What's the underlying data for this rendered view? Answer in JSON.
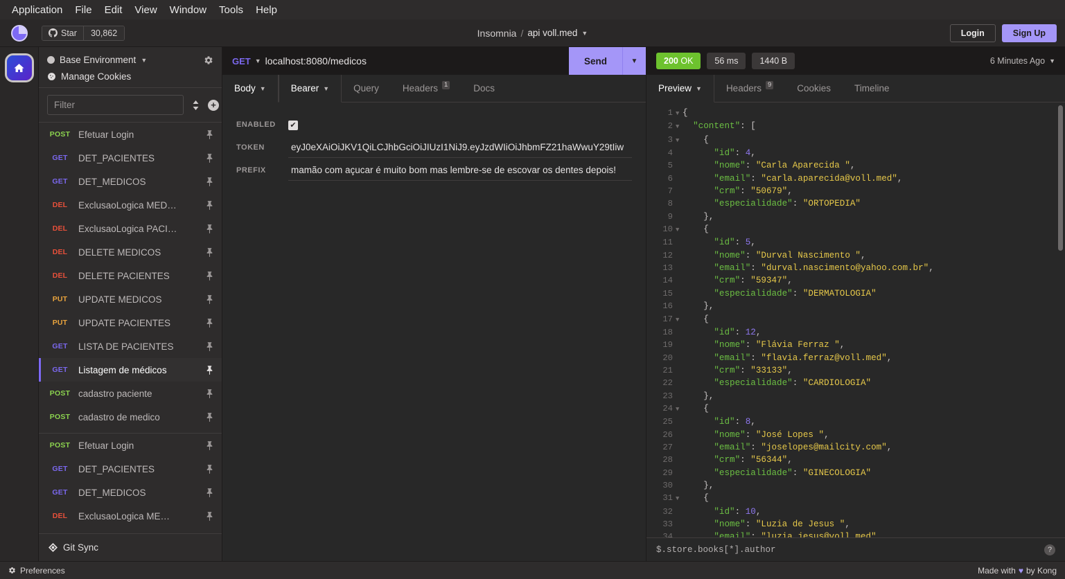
{
  "menubar": [
    "Application",
    "File",
    "Edit",
    "View",
    "Window",
    "Tools",
    "Help"
  ],
  "header": {
    "star_label": "Star",
    "star_count": "30,862",
    "app_name": "Insomnia",
    "separator": "/",
    "workspace": "api voll.med",
    "login_label": "Login",
    "signup_label": "Sign Up",
    "accent": "#a496f8"
  },
  "sidebar": {
    "environment": "Base Environment",
    "manage_cookies": "Manage Cookies",
    "filter_placeholder": "Filter",
    "git_sync": "Git Sync",
    "requests": [
      {
        "method": "POST",
        "name": "Efetuar Login",
        "active": false
      },
      {
        "method": "GET",
        "name": "DET_PACIENTES",
        "active": false
      },
      {
        "method": "GET",
        "name": "DET_MEDICOS",
        "active": false
      },
      {
        "method": "DEL",
        "name": "ExclusaoLogica MED…",
        "active": false
      },
      {
        "method": "DEL",
        "name": "ExclusaoLogica PACI…",
        "active": false
      },
      {
        "method": "DEL",
        "name": "DELETE MEDICOS",
        "active": false
      },
      {
        "method": "DEL",
        "name": "DELETE PACIENTES",
        "active": false
      },
      {
        "method": "PUT",
        "name": "UPDATE MEDICOS",
        "active": false
      },
      {
        "method": "PUT",
        "name": "UPDATE PACIENTES",
        "active": false
      },
      {
        "method": "GET",
        "name": "LISTA DE PACIENTES",
        "active": false
      },
      {
        "method": "GET",
        "name": "Listagem de médicos",
        "active": true
      },
      {
        "method": "POST",
        "name": "cadastro paciente",
        "active": false
      },
      {
        "method": "POST",
        "name": "cadastro de medico",
        "active": false
      }
    ],
    "requests_group2": [
      {
        "method": "POST",
        "name": "Efetuar Login",
        "active": false
      },
      {
        "method": "GET",
        "name": "DET_PACIENTES",
        "active": false
      },
      {
        "method": "GET",
        "name": "DET_MEDICOS",
        "active": false
      },
      {
        "method": "DEL",
        "name": "ExclusaoLogica ME…",
        "active": false
      }
    ]
  },
  "request": {
    "method": "GET",
    "url": "localhost:8080/medicos",
    "send_label": "Send",
    "tabs": [
      {
        "label": "Body",
        "active": true,
        "caret": true,
        "badge": ""
      },
      {
        "label": "Bearer",
        "active": true,
        "caret": true,
        "badge": ""
      },
      {
        "label": "Query",
        "active": false,
        "caret": false,
        "badge": ""
      },
      {
        "label": "Headers",
        "active": false,
        "caret": false,
        "badge": "1"
      },
      {
        "label": "Docs",
        "active": false,
        "caret": false,
        "badge": ""
      }
    ],
    "fields": {
      "enabled_label": "ENABLED",
      "enabled_checked": true,
      "token_label": "TOKEN",
      "token_value": "eyJ0eXAiOiJKV1QiLCJhbGciOiJIUzI1NiJ9.eyJzdWIiOiJhbmFZ21haWwuY29tIiw",
      "prefix_label": "PREFIX",
      "prefix_value": "mamão com açucar é muito bom mas lembre-se de escovar os dentes depois!"
    }
  },
  "response": {
    "status_code": "200",
    "status_text": "OK",
    "time": "56 ms",
    "size": "1440 B",
    "time_ago": "6 Minutes Ago",
    "tabs": [
      {
        "label": "Preview",
        "active": true,
        "caret": true,
        "badge": ""
      },
      {
        "label": "Headers",
        "active": false,
        "caret": false,
        "badge": "9"
      },
      {
        "label": "Cookies",
        "active": false,
        "caret": false,
        "badge": ""
      },
      {
        "label": "Timeline",
        "active": false,
        "caret": false,
        "badge": ""
      }
    ],
    "jsonpath_filter": "$.store.books[*].author",
    "body_lines": [
      {
        "num": 1,
        "fold": true,
        "tokens": [
          {
            "t": "p",
            "v": "{"
          }
        ]
      },
      {
        "num": 2,
        "fold": true,
        "tokens": [
          {
            "t": "p",
            "v": "  "
          },
          {
            "t": "k",
            "v": "\"content\""
          },
          {
            "t": "p",
            "v": ": ["
          }
        ]
      },
      {
        "num": 3,
        "fold": true,
        "tokens": [
          {
            "t": "p",
            "v": "    {"
          }
        ]
      },
      {
        "num": 4,
        "fold": false,
        "tokens": [
          {
            "t": "p",
            "v": "      "
          },
          {
            "t": "k",
            "v": "\"id\""
          },
          {
            "t": "p",
            "v": ": "
          },
          {
            "t": "n",
            "v": "4"
          },
          {
            "t": "p",
            "v": ","
          }
        ]
      },
      {
        "num": 5,
        "fold": false,
        "tokens": [
          {
            "t": "p",
            "v": "      "
          },
          {
            "t": "k",
            "v": "\"nome\""
          },
          {
            "t": "p",
            "v": ": "
          },
          {
            "t": "s",
            "v": "\"Carla Aparecida \""
          },
          {
            "t": "p",
            "v": ","
          }
        ]
      },
      {
        "num": 6,
        "fold": false,
        "tokens": [
          {
            "t": "p",
            "v": "      "
          },
          {
            "t": "k",
            "v": "\"email\""
          },
          {
            "t": "p",
            "v": ": "
          },
          {
            "t": "s",
            "v": "\"carla.aparecida@voll.med\""
          },
          {
            "t": "p",
            "v": ","
          }
        ]
      },
      {
        "num": 7,
        "fold": false,
        "tokens": [
          {
            "t": "p",
            "v": "      "
          },
          {
            "t": "k",
            "v": "\"crm\""
          },
          {
            "t": "p",
            "v": ": "
          },
          {
            "t": "s",
            "v": "\"50679\""
          },
          {
            "t": "p",
            "v": ","
          }
        ]
      },
      {
        "num": 8,
        "fold": false,
        "tokens": [
          {
            "t": "p",
            "v": "      "
          },
          {
            "t": "k",
            "v": "\"especialidade\""
          },
          {
            "t": "p",
            "v": ": "
          },
          {
            "t": "s",
            "v": "\"ORTOPEDIA\""
          }
        ]
      },
      {
        "num": 9,
        "fold": false,
        "tokens": [
          {
            "t": "p",
            "v": "    },"
          }
        ]
      },
      {
        "num": 10,
        "fold": true,
        "tokens": [
          {
            "t": "p",
            "v": "    {"
          }
        ]
      },
      {
        "num": 11,
        "fold": false,
        "tokens": [
          {
            "t": "p",
            "v": "      "
          },
          {
            "t": "k",
            "v": "\"id\""
          },
          {
            "t": "p",
            "v": ": "
          },
          {
            "t": "n",
            "v": "5"
          },
          {
            "t": "p",
            "v": ","
          }
        ]
      },
      {
        "num": 12,
        "fold": false,
        "tokens": [
          {
            "t": "p",
            "v": "      "
          },
          {
            "t": "k",
            "v": "\"nome\""
          },
          {
            "t": "p",
            "v": ": "
          },
          {
            "t": "s",
            "v": "\"Durval Nascimento \""
          },
          {
            "t": "p",
            "v": ","
          }
        ]
      },
      {
        "num": 13,
        "fold": false,
        "tokens": [
          {
            "t": "p",
            "v": "      "
          },
          {
            "t": "k",
            "v": "\"email\""
          },
          {
            "t": "p",
            "v": ": "
          },
          {
            "t": "s",
            "v": "\"durval.nascimento@yahoo.com.br\""
          },
          {
            "t": "p",
            "v": ","
          }
        ]
      },
      {
        "num": 14,
        "fold": false,
        "tokens": [
          {
            "t": "p",
            "v": "      "
          },
          {
            "t": "k",
            "v": "\"crm\""
          },
          {
            "t": "p",
            "v": ": "
          },
          {
            "t": "s",
            "v": "\"59347\""
          },
          {
            "t": "p",
            "v": ","
          }
        ]
      },
      {
        "num": 15,
        "fold": false,
        "tokens": [
          {
            "t": "p",
            "v": "      "
          },
          {
            "t": "k",
            "v": "\"especialidade\""
          },
          {
            "t": "p",
            "v": ": "
          },
          {
            "t": "s",
            "v": "\"DERMATOLOGIA\""
          }
        ]
      },
      {
        "num": 16,
        "fold": false,
        "tokens": [
          {
            "t": "p",
            "v": "    },"
          }
        ]
      },
      {
        "num": 17,
        "fold": true,
        "tokens": [
          {
            "t": "p",
            "v": "    {"
          }
        ]
      },
      {
        "num": 18,
        "fold": false,
        "tokens": [
          {
            "t": "p",
            "v": "      "
          },
          {
            "t": "k",
            "v": "\"id\""
          },
          {
            "t": "p",
            "v": ": "
          },
          {
            "t": "n",
            "v": "12"
          },
          {
            "t": "p",
            "v": ","
          }
        ]
      },
      {
        "num": 19,
        "fold": false,
        "tokens": [
          {
            "t": "p",
            "v": "      "
          },
          {
            "t": "k",
            "v": "\"nome\""
          },
          {
            "t": "p",
            "v": ": "
          },
          {
            "t": "s",
            "v": "\"Flávia Ferraz \""
          },
          {
            "t": "p",
            "v": ","
          }
        ]
      },
      {
        "num": 20,
        "fold": false,
        "tokens": [
          {
            "t": "p",
            "v": "      "
          },
          {
            "t": "k",
            "v": "\"email\""
          },
          {
            "t": "p",
            "v": ": "
          },
          {
            "t": "s",
            "v": "\"flavia.ferraz@voll.med\""
          },
          {
            "t": "p",
            "v": ","
          }
        ]
      },
      {
        "num": 21,
        "fold": false,
        "tokens": [
          {
            "t": "p",
            "v": "      "
          },
          {
            "t": "k",
            "v": "\"crm\""
          },
          {
            "t": "p",
            "v": ": "
          },
          {
            "t": "s",
            "v": "\"33133\""
          },
          {
            "t": "p",
            "v": ","
          }
        ]
      },
      {
        "num": 22,
        "fold": false,
        "tokens": [
          {
            "t": "p",
            "v": "      "
          },
          {
            "t": "k",
            "v": "\"especialidade\""
          },
          {
            "t": "p",
            "v": ": "
          },
          {
            "t": "s",
            "v": "\"CARDIOLOGIA\""
          }
        ]
      },
      {
        "num": 23,
        "fold": false,
        "tokens": [
          {
            "t": "p",
            "v": "    },"
          }
        ]
      },
      {
        "num": 24,
        "fold": true,
        "tokens": [
          {
            "t": "p",
            "v": "    {"
          }
        ]
      },
      {
        "num": 25,
        "fold": false,
        "tokens": [
          {
            "t": "p",
            "v": "      "
          },
          {
            "t": "k",
            "v": "\"id\""
          },
          {
            "t": "p",
            "v": ": "
          },
          {
            "t": "n",
            "v": "8"
          },
          {
            "t": "p",
            "v": ","
          }
        ]
      },
      {
        "num": 26,
        "fold": false,
        "tokens": [
          {
            "t": "p",
            "v": "      "
          },
          {
            "t": "k",
            "v": "\"nome\""
          },
          {
            "t": "p",
            "v": ": "
          },
          {
            "t": "s",
            "v": "\"José Lopes \""
          },
          {
            "t": "p",
            "v": ","
          }
        ]
      },
      {
        "num": 27,
        "fold": false,
        "tokens": [
          {
            "t": "p",
            "v": "      "
          },
          {
            "t": "k",
            "v": "\"email\""
          },
          {
            "t": "p",
            "v": ": "
          },
          {
            "t": "s",
            "v": "\"joselopes@mailcity.com\""
          },
          {
            "t": "p",
            "v": ","
          }
        ]
      },
      {
        "num": 28,
        "fold": false,
        "tokens": [
          {
            "t": "p",
            "v": "      "
          },
          {
            "t": "k",
            "v": "\"crm\""
          },
          {
            "t": "p",
            "v": ": "
          },
          {
            "t": "s",
            "v": "\"56344\""
          },
          {
            "t": "p",
            "v": ","
          }
        ]
      },
      {
        "num": 29,
        "fold": false,
        "tokens": [
          {
            "t": "p",
            "v": "      "
          },
          {
            "t": "k",
            "v": "\"especialidade\""
          },
          {
            "t": "p",
            "v": ": "
          },
          {
            "t": "s",
            "v": "\"GINECOLOGIA\""
          }
        ]
      },
      {
        "num": 30,
        "fold": false,
        "tokens": [
          {
            "t": "p",
            "v": "    },"
          }
        ]
      },
      {
        "num": 31,
        "fold": true,
        "tokens": [
          {
            "t": "p",
            "v": "    {"
          }
        ]
      },
      {
        "num": 32,
        "fold": false,
        "tokens": [
          {
            "t": "p",
            "v": "      "
          },
          {
            "t": "k",
            "v": "\"id\""
          },
          {
            "t": "p",
            "v": ": "
          },
          {
            "t": "n",
            "v": "10"
          },
          {
            "t": "p",
            "v": ","
          }
        ]
      },
      {
        "num": 33,
        "fold": false,
        "tokens": [
          {
            "t": "p",
            "v": "      "
          },
          {
            "t": "k",
            "v": "\"nome\""
          },
          {
            "t": "p",
            "v": ": "
          },
          {
            "t": "s",
            "v": "\"Luzia de Jesus \""
          },
          {
            "t": "p",
            "v": ","
          }
        ]
      },
      {
        "num": 34,
        "fold": false,
        "tokens": [
          {
            "t": "p",
            "v": "      "
          },
          {
            "t": "k",
            "v": "\"email\""
          },
          {
            "t": "p",
            "v": ": "
          },
          {
            "t": "s",
            "v": "\"luzia.jesus@voll.med\""
          },
          {
            "t": "p",
            "v": ","
          }
        ]
      }
    ]
  },
  "footer": {
    "preferences": "Preferences",
    "made_with_prefix": "Made with",
    "made_with_suffix": "by Kong"
  }
}
